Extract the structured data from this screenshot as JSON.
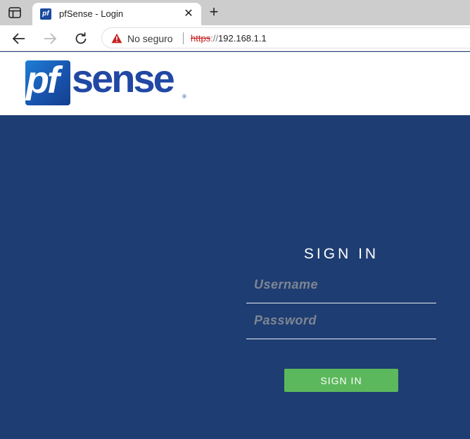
{
  "browser": {
    "tab": {
      "favicon_text": "pf",
      "title": "pfSense - Login",
      "close_glyph": "✕"
    },
    "new_tab_glyph": "+",
    "address_bar": {
      "security_label": "No seguro",
      "url_scheme": "https",
      "url_separator": "://",
      "url_host": "192.168.1.1"
    },
    "icons": [
      "tab-actions-icon",
      "back-arrow-icon",
      "forward-arrow-icon",
      "reload-icon",
      "warning-icon"
    ]
  },
  "header": {
    "logo_pf": "pf",
    "logo_sense": "sense",
    "logo_reg": "®"
  },
  "login": {
    "title": "SIGN IN",
    "username_placeholder": "Username",
    "password_placeholder": "Password",
    "button_label": "SIGN IN"
  },
  "colors": {
    "brand_blue": "#1e3d72",
    "logo_blue": "#2148a4",
    "button_green": "#5cb85c",
    "insecure_red": "#c5221f"
  }
}
